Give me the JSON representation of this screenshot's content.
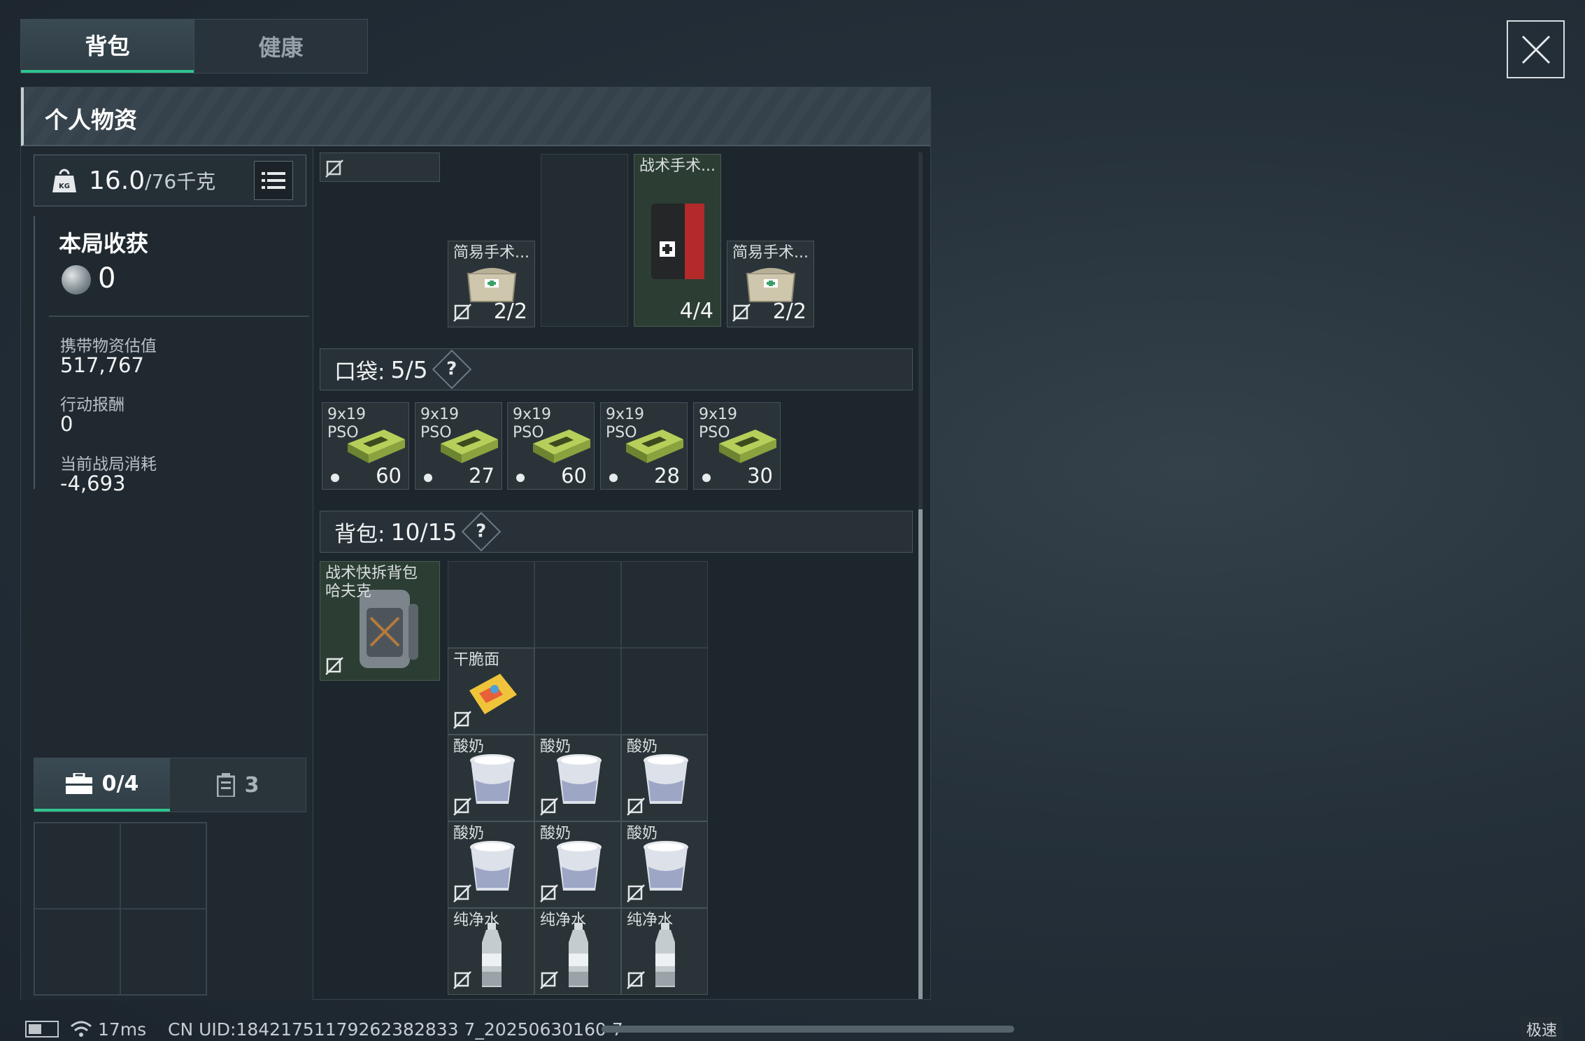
{
  "tabs": [
    {
      "label": "背包",
      "active": true
    },
    {
      "label": "健康",
      "active": false
    }
  ],
  "panel": {
    "title": "个人物资"
  },
  "weight": {
    "current": "16.0",
    "max": "/76千克"
  },
  "harvest": {
    "title": "本局收获",
    "count": "0",
    "stats": [
      {
        "label": "携带物资估值",
        "value": "517,767"
      },
      {
        "label": "行动报酬",
        "value": "0"
      },
      {
        "label": "当前战局消耗",
        "value": "-4,693"
      }
    ]
  },
  "side_tabs": [
    {
      "label": "0/4",
      "icon": "case-icon",
      "active": true
    },
    {
      "label": "3",
      "icon": "canister-icon",
      "active": false
    }
  ],
  "gear_items": [
    {
      "name": "简易手术...",
      "count": "2/2",
      "icon": "surgery-pouch-icon"
    },
    {
      "name": "战术手术...",
      "count": "4/4",
      "icon": "tactical-surgery-kit-icon"
    },
    {
      "name": "简易手术...",
      "count": "2/2",
      "icon": "surgery-pouch-icon"
    }
  ],
  "pocket": {
    "label": "口袋:",
    "value": "5/5",
    "items": [
      {
        "name": "9x19",
        "sub": "PSO",
        "count": "60"
      },
      {
        "name": "9x19",
        "sub": "PSO",
        "count": "27"
      },
      {
        "name": "9x19",
        "sub": "PSO",
        "count": "60"
      },
      {
        "name": "9x19",
        "sub": "PSO",
        "count": "28"
      },
      {
        "name": "9x19",
        "sub": "PSO",
        "count": "30"
      }
    ]
  },
  "backpack": {
    "label": "背包:",
    "value": "10/15",
    "equipped": {
      "name_line1": "战术快拆背包",
      "name_line2": "哈夫克"
    },
    "items": [
      {
        "name": "干脆面",
        "icon": "snack-icon"
      },
      {
        "name": "酸奶",
        "icon": "yogurt-icon"
      },
      {
        "name": "酸奶",
        "icon": "yogurt-icon"
      },
      {
        "name": "酸奶",
        "icon": "yogurt-icon"
      },
      {
        "name": "酸奶",
        "icon": "yogurt-icon"
      },
      {
        "name": "酸奶",
        "icon": "yogurt-icon"
      },
      {
        "name": "酸奶",
        "icon": "yogurt-icon"
      },
      {
        "name": "纯净水",
        "icon": "water-bottle-icon"
      },
      {
        "name": "纯净水",
        "icon": "water-bottle-icon"
      },
      {
        "name": "纯净水",
        "icon": "water-bottle-icon"
      }
    ]
  },
  "footer": {
    "latency": "17ms",
    "uid": "CN UID:18421751179262382833 7_20250630160 7",
    "speed": "极速"
  },
  "colors": {
    "accent": "#2ec48e",
    "panel": "#1d262d",
    "slot_green": "#2c3d33"
  }
}
